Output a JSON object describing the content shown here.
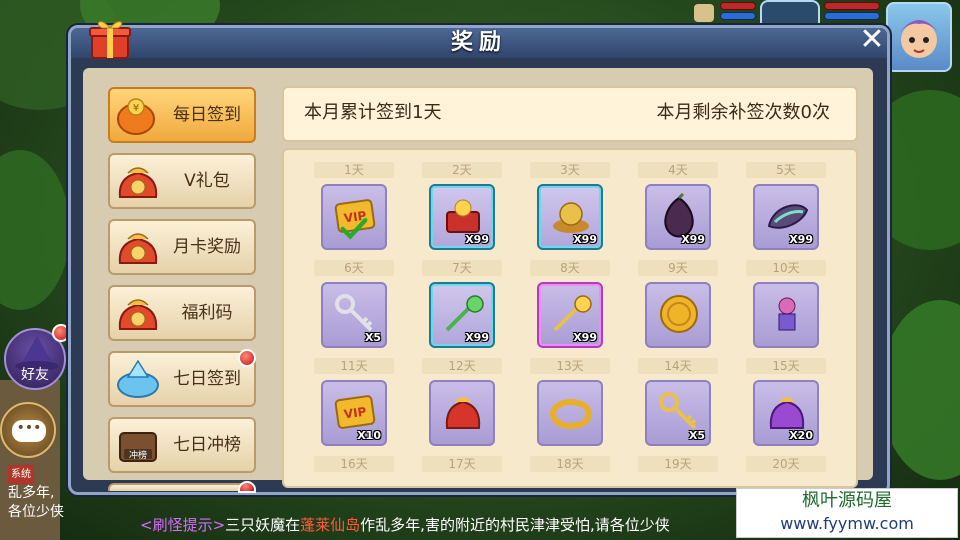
{
  "panel": {
    "title": "奖励"
  },
  "sidebar": {
    "items": [
      {
        "label": "每日签到",
        "icon": "coin-bag-icon",
        "active": true
      },
      {
        "label": "V礼包",
        "icon": "lucky-bag-icon"
      },
      {
        "label": "月卡奖励",
        "icon": "lucky-bag-icon"
      },
      {
        "label": "福利码",
        "icon": "lucky-bag-icon"
      },
      {
        "label": "七日签到",
        "icon": "crystal-icon",
        "badge": true
      },
      {
        "label": "七日冲榜",
        "icon": "chest-icon",
        "icon_text": "冲榜"
      }
    ]
  },
  "info": {
    "signed_text": "本月累计签到1天",
    "makeup_text": "本月剩余补签次数0次"
  },
  "days": [
    {
      "label": "1天",
      "item": "vip-card",
      "claimed": true
    },
    {
      "label": "2天",
      "item": "treasure-chest",
      "qty": "X99",
      "frame": "blue"
    },
    {
      "label": "3天",
      "item": "gold-ingot",
      "qty": "X99",
      "frame": "blue"
    },
    {
      "label": "4天",
      "item": "dark-gourd",
      "qty": "X99"
    },
    {
      "label": "5天",
      "item": "feather-stone",
      "qty": "X99"
    },
    {
      "label": "6天",
      "item": "silver-key",
      "qty": "X5"
    },
    {
      "label": "7天",
      "item": "green-wand",
      "qty": "X99",
      "frame": "blue"
    },
    {
      "label": "8天",
      "item": "gold-wand",
      "qty": "X99",
      "frame": "purple"
    },
    {
      "label": "9天",
      "item": "gold-coin"
    },
    {
      "label": "10天",
      "item": "mask-figure"
    },
    {
      "label": "11天",
      "item": "vip-card",
      "qty": "X10"
    },
    {
      "label": "12天",
      "item": "red-bag"
    },
    {
      "label": "13天",
      "item": "gold-ring"
    },
    {
      "label": "14天",
      "item": "gold-key",
      "qty": "X5"
    },
    {
      "label": "15天",
      "item": "purple-bag",
      "qty": "X20"
    },
    {
      "label": "16天"
    },
    {
      "label": "17天"
    },
    {
      "label": "18天"
    },
    {
      "label": "19天"
    },
    {
      "label": "20天"
    }
  ],
  "hud": {
    "friend_label": "好友",
    "chat_label": "•••",
    "log": [
      "系统",
      "乱多年,",
      "各位少侠"
    ]
  },
  "ticker": {
    "tag": "<刷怪提示>",
    "part1": "三只妖魔在",
    "place": "蓬莱仙岛",
    "part2": "作乱多年,害的附近的村民津津受怕,请各位少侠"
  },
  "watermark": {
    "line1": "枫叶源码屋",
    "line2": "www.fyymw.com"
  },
  "colors": {
    "accent_orange": "#f0a93e",
    "panel_blue": "#30456c",
    "badge_red": "#c2140f"
  }
}
